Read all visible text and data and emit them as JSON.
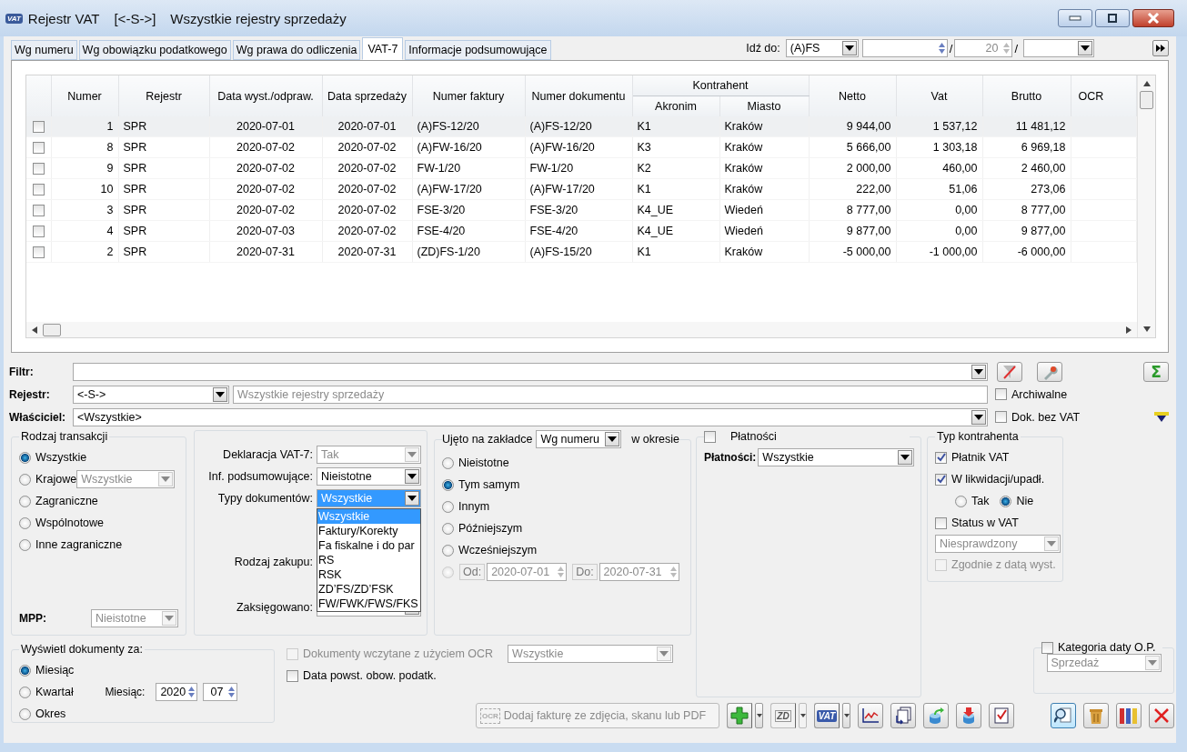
{
  "window": {
    "icon_text": "VAT",
    "title": "Rejestr VAT",
    "register": "[<-S->]",
    "subtitle": "Wszystkie rejestry sprzedaży"
  },
  "tabs": [
    {
      "label": "Wg numeru",
      "selected": false
    },
    {
      "label": "Wg obowiązku podatkowego",
      "selected": false
    },
    {
      "label": "Wg prawa do odliczenia",
      "selected": false
    },
    {
      "label": "VAT-7",
      "selected": true
    },
    {
      "label": "Informacje podsumowujące",
      "selected": false
    }
  ],
  "goto": {
    "label": "Idź do:",
    "type": "(A)FS",
    "separator_1": "/",
    "count": "20",
    "separator_2": "/"
  },
  "table": {
    "columns_before": [
      "Numer",
      "Rejestr",
      "Data wyst./odpraw.",
      "Data sprzedaży",
      "Numer faktury",
      "Numer dokumentu"
    ],
    "group": {
      "label": "Kontrahent",
      "columns": [
        "Akronim",
        "Miasto"
      ]
    },
    "columns_after": [
      "Netto",
      "Vat",
      "Brutto",
      "OCR"
    ],
    "rows": [
      {
        "checked": false,
        "selected": true,
        "cells": [
          "1",
          "SPR",
          "2020-07-01",
          "2020-07-01",
          "(A)FS-12/20",
          "(A)FS-12/20",
          "K1",
          "Kraków",
          "9 944,00",
          "1 537,12",
          "11 481,12"
        ]
      },
      {
        "checked": false,
        "selected": false,
        "cells": [
          "8",
          "SPR",
          "2020-07-02",
          "2020-07-02",
          "(A)FW-16/20",
          "(A)FW-16/20",
          "K3",
          "Kraków",
          "5 666,00",
          "1 303,18",
          "6 969,18"
        ]
      },
      {
        "checked": false,
        "selected": false,
        "cells": [
          "9",
          "SPR",
          "2020-07-02",
          "2020-07-02",
          "FW-1/20",
          "FW-1/20",
          "K2",
          "Kraków",
          "2 000,00",
          "460,00",
          "2 460,00"
        ]
      },
      {
        "checked": false,
        "selected": false,
        "cells": [
          "10",
          "SPR",
          "2020-07-02",
          "2020-07-02",
          "(A)FW-17/20",
          "(A)FW-17/20",
          "K1",
          "Kraków",
          "222,00",
          "51,06",
          "273,06"
        ]
      },
      {
        "checked": false,
        "selected": false,
        "cells": [
          "3",
          "SPR",
          "2020-07-02",
          "2020-07-02",
          "FSE-3/20",
          "FSE-3/20",
          "K4_UE",
          "Wiedeń",
          "8 777,00",
          "0,00",
          "8 777,00"
        ]
      },
      {
        "checked": false,
        "selected": false,
        "cells": [
          "4",
          "SPR",
          "2020-07-03",
          "2020-07-02",
          "FSE-4/20",
          "FSE-4/20",
          "K4_UE",
          "Wiedeń",
          "9 877,00",
          "0,00",
          "9 877,00"
        ]
      },
      {
        "checked": false,
        "selected": false,
        "cells": [
          "2",
          "SPR",
          "2020-07-31",
          "2020-07-31",
          "(ZD)FS-1/20",
          "(A)FS-15/20",
          "K1",
          "Kraków",
          "-5 000,00",
          "-1 000,00",
          "-6 000,00"
        ]
      }
    ]
  },
  "filters": {
    "filter_label": "Filtr:",
    "register_label": "Rejestr:",
    "register_code": "<-S->",
    "register_name": "Wszystkie rejestry sprzedaży",
    "owner_label": "Właściciel:",
    "owner": "<Wszystkie>",
    "sigma": "Σ",
    "archived": {
      "label": "Archiwalne",
      "checked": false
    },
    "no_vat": {
      "label": "Dok. bez VAT",
      "checked": false
    }
  },
  "transaction_type": {
    "title": "Rodzaj transakcji",
    "options": [
      {
        "label": "Wszystkie",
        "selected": true
      },
      {
        "label": "Krajowe",
        "selected": false,
        "combo": {
          "value": "Wszystkie",
          "disabled": true
        }
      },
      {
        "label": "Zagraniczne",
        "selected": false
      },
      {
        "label": "Wspólnotowe",
        "selected": false
      },
      {
        "label": "Inne zagraniczne",
        "selected": false
      }
    ],
    "mpp_label": "MPP:",
    "mpp": {
      "value": "Nieistotne",
      "disabled": true
    }
  },
  "declaration": {
    "fields": [
      {
        "kind": "combo",
        "label": "Deklaracja VAT-7:",
        "value": "Tak",
        "disabled": true,
        "expanded": false
      },
      {
        "kind": "combo",
        "label": "Inf. podsumowujące:",
        "value": "Nieistotne",
        "disabled": false,
        "expanded": false
      },
      {
        "kind": "combo",
        "label": "Typy dokumentów:",
        "value": "Wszystkie",
        "disabled": false,
        "expanded": true,
        "options": [
          {
            "label": "Wszystkie",
            "selected": true
          },
          {
            "label": "Faktury/Korekty",
            "selected": false
          },
          {
            "label": "Fa fiskalne i do par",
            "selected": false
          },
          {
            "label": "RS",
            "selected": false
          },
          {
            "label": "RSK",
            "selected": false
          },
          {
            "label": "ZD’FS/ZD’FSK",
            "selected": false
          },
          {
            "label": "FW/FWK/FWS/FKS",
            "selected": false
          }
        ]
      },
      {
        "kind": "label",
        "label": "Rodzaj zakupu:"
      },
      {
        "kind": "combo",
        "label": "Zaksięgowano:",
        "disabled": false,
        "expanded": false
      }
    ]
  },
  "period": {
    "label": "Ujęto na zakładce",
    "tab_combo": "Wg numeru",
    "in_period": "w okresie",
    "options": [
      {
        "kind": "plain",
        "label": "Nieistotne",
        "selected": false
      },
      {
        "kind": "plain",
        "label": "Tym samym",
        "selected": true
      },
      {
        "kind": "plain",
        "label": "Innym",
        "selected": false
      },
      {
        "kind": "plain",
        "label": "Późniejszym",
        "selected": false
      },
      {
        "kind": "plain",
        "label": "Wcześniejszym",
        "selected": false
      },
      {
        "kind": "range",
        "selected": false,
        "disabled": true,
        "from_label": "Od:",
        "from": "2020-07-01",
        "to_label": "Do:",
        "to": "2020-07-31"
      }
    ]
  },
  "payments": {
    "checked": false,
    "title": "Płatności",
    "label": "Płatności:",
    "value": "Wszystkie"
  },
  "contractor_type": {
    "title": "Typ kontrahenta",
    "vat_payer": {
      "label": "Płatnik VAT",
      "checked": true
    },
    "liquidation": {
      "label": "W likwidacji/upadł.",
      "checked": true,
      "options": [
        {
          "label": "Tak",
          "selected": false
        },
        {
          "label": "Nie",
          "selected": true
        }
      ]
    },
    "vat_status": {
      "label": "Status w VAT",
      "checked": false,
      "value": "Niesprawdzony",
      "disabled": true
    },
    "by_issue_date": {
      "label": "Zgodnie z datą wyst.",
      "checked": false,
      "disabled": true
    }
  },
  "display": {
    "title": "Wyświetl dokumenty za:",
    "options": [
      {
        "label": "Miesiąc",
        "selected": true
      },
      {
        "label": "Kwartał",
        "selected": false
      },
      {
        "label": "Okres",
        "selected": false
      }
    ],
    "month_label": "Miesiąc:",
    "year": "2020",
    "month": "07"
  },
  "ocr": {
    "label": "Dokumenty wczytane z użyciem OCR",
    "checked": false,
    "disabled": true,
    "value": "Wszystkie"
  },
  "tax_date": {
    "label": "Data powst. obow. podatk.",
    "checked": false
  },
  "date_category": {
    "label": "Kategoria daty O.P.",
    "checked": false,
    "value": "Sprzedaż",
    "disabled": true
  },
  "toolbar": {
    "ocr_button": {
      "icon_text": "OCR",
      "label": "Dodaj fakturę ze zdjęcia, skanu lub PDF",
      "disabled": true
    },
    "buttons": [
      {
        "kind": "add",
        "menu": true,
        "disabled": false
      },
      {
        "kind": "zd",
        "text": "ZD",
        "menu": true,
        "disabled": true
      },
      {
        "kind": "vat",
        "text": "VAT",
        "menu": true,
        "disabled": false
      },
      {
        "kind": "chart",
        "menu": false,
        "disabled": false
      },
      {
        "kind": "docs",
        "menu": false,
        "disabled": false
      },
      {
        "kind": "export",
        "menu": false,
        "disabled": false
      },
      {
        "kind": "import",
        "menu": false,
        "disabled": false
      },
      {
        "kind": "check",
        "menu": false,
        "disabled": false
      }
    ],
    "right_buttons": [
      {
        "kind": "preview",
        "focused": true
      },
      {
        "kind": "delete",
        "focused": false
      },
      {
        "kind": "binders",
        "focused": false
      },
      {
        "kind": "close",
        "focused": false
      }
    ]
  }
}
